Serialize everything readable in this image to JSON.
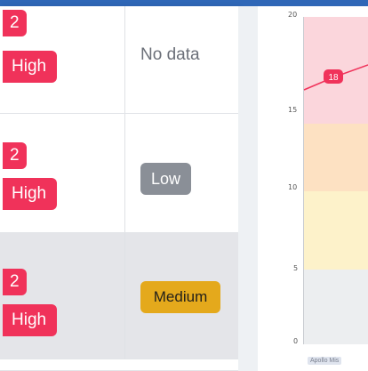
{
  "table": {
    "rows": [
      {
        "count": "2",
        "level": "High",
        "status": "No data"
      },
      {
        "count": "2",
        "level": "High",
        "status": "Low"
      },
      {
        "count": "2",
        "level": "High",
        "status": "Medium"
      }
    ]
  },
  "chart_data": {
    "type": "line",
    "y_ticks": [
      "20",
      "15",
      "10",
      "5",
      "0"
    ],
    "ylim": [
      0,
      20
    ],
    "bands": [
      {
        "from": 15,
        "to": 20,
        "color": "#fbd6dc"
      },
      {
        "from": 11,
        "to": 15,
        "color": "#fde1c2"
      },
      {
        "from": 5,
        "to": 11,
        "color": "#fdf2ca"
      },
      {
        "from": 0,
        "to": 5,
        "color": "#eceef0"
      }
    ],
    "series": [
      {
        "values": [
          17,
          18,
          19
        ]
      }
    ],
    "point_label": "18",
    "x_label": "Apollo Mis"
  },
  "colors": {
    "high": "#f0325a",
    "low": "#8a8f97",
    "medium": "#e4a91c",
    "accent_bar": "#2f67b7"
  }
}
